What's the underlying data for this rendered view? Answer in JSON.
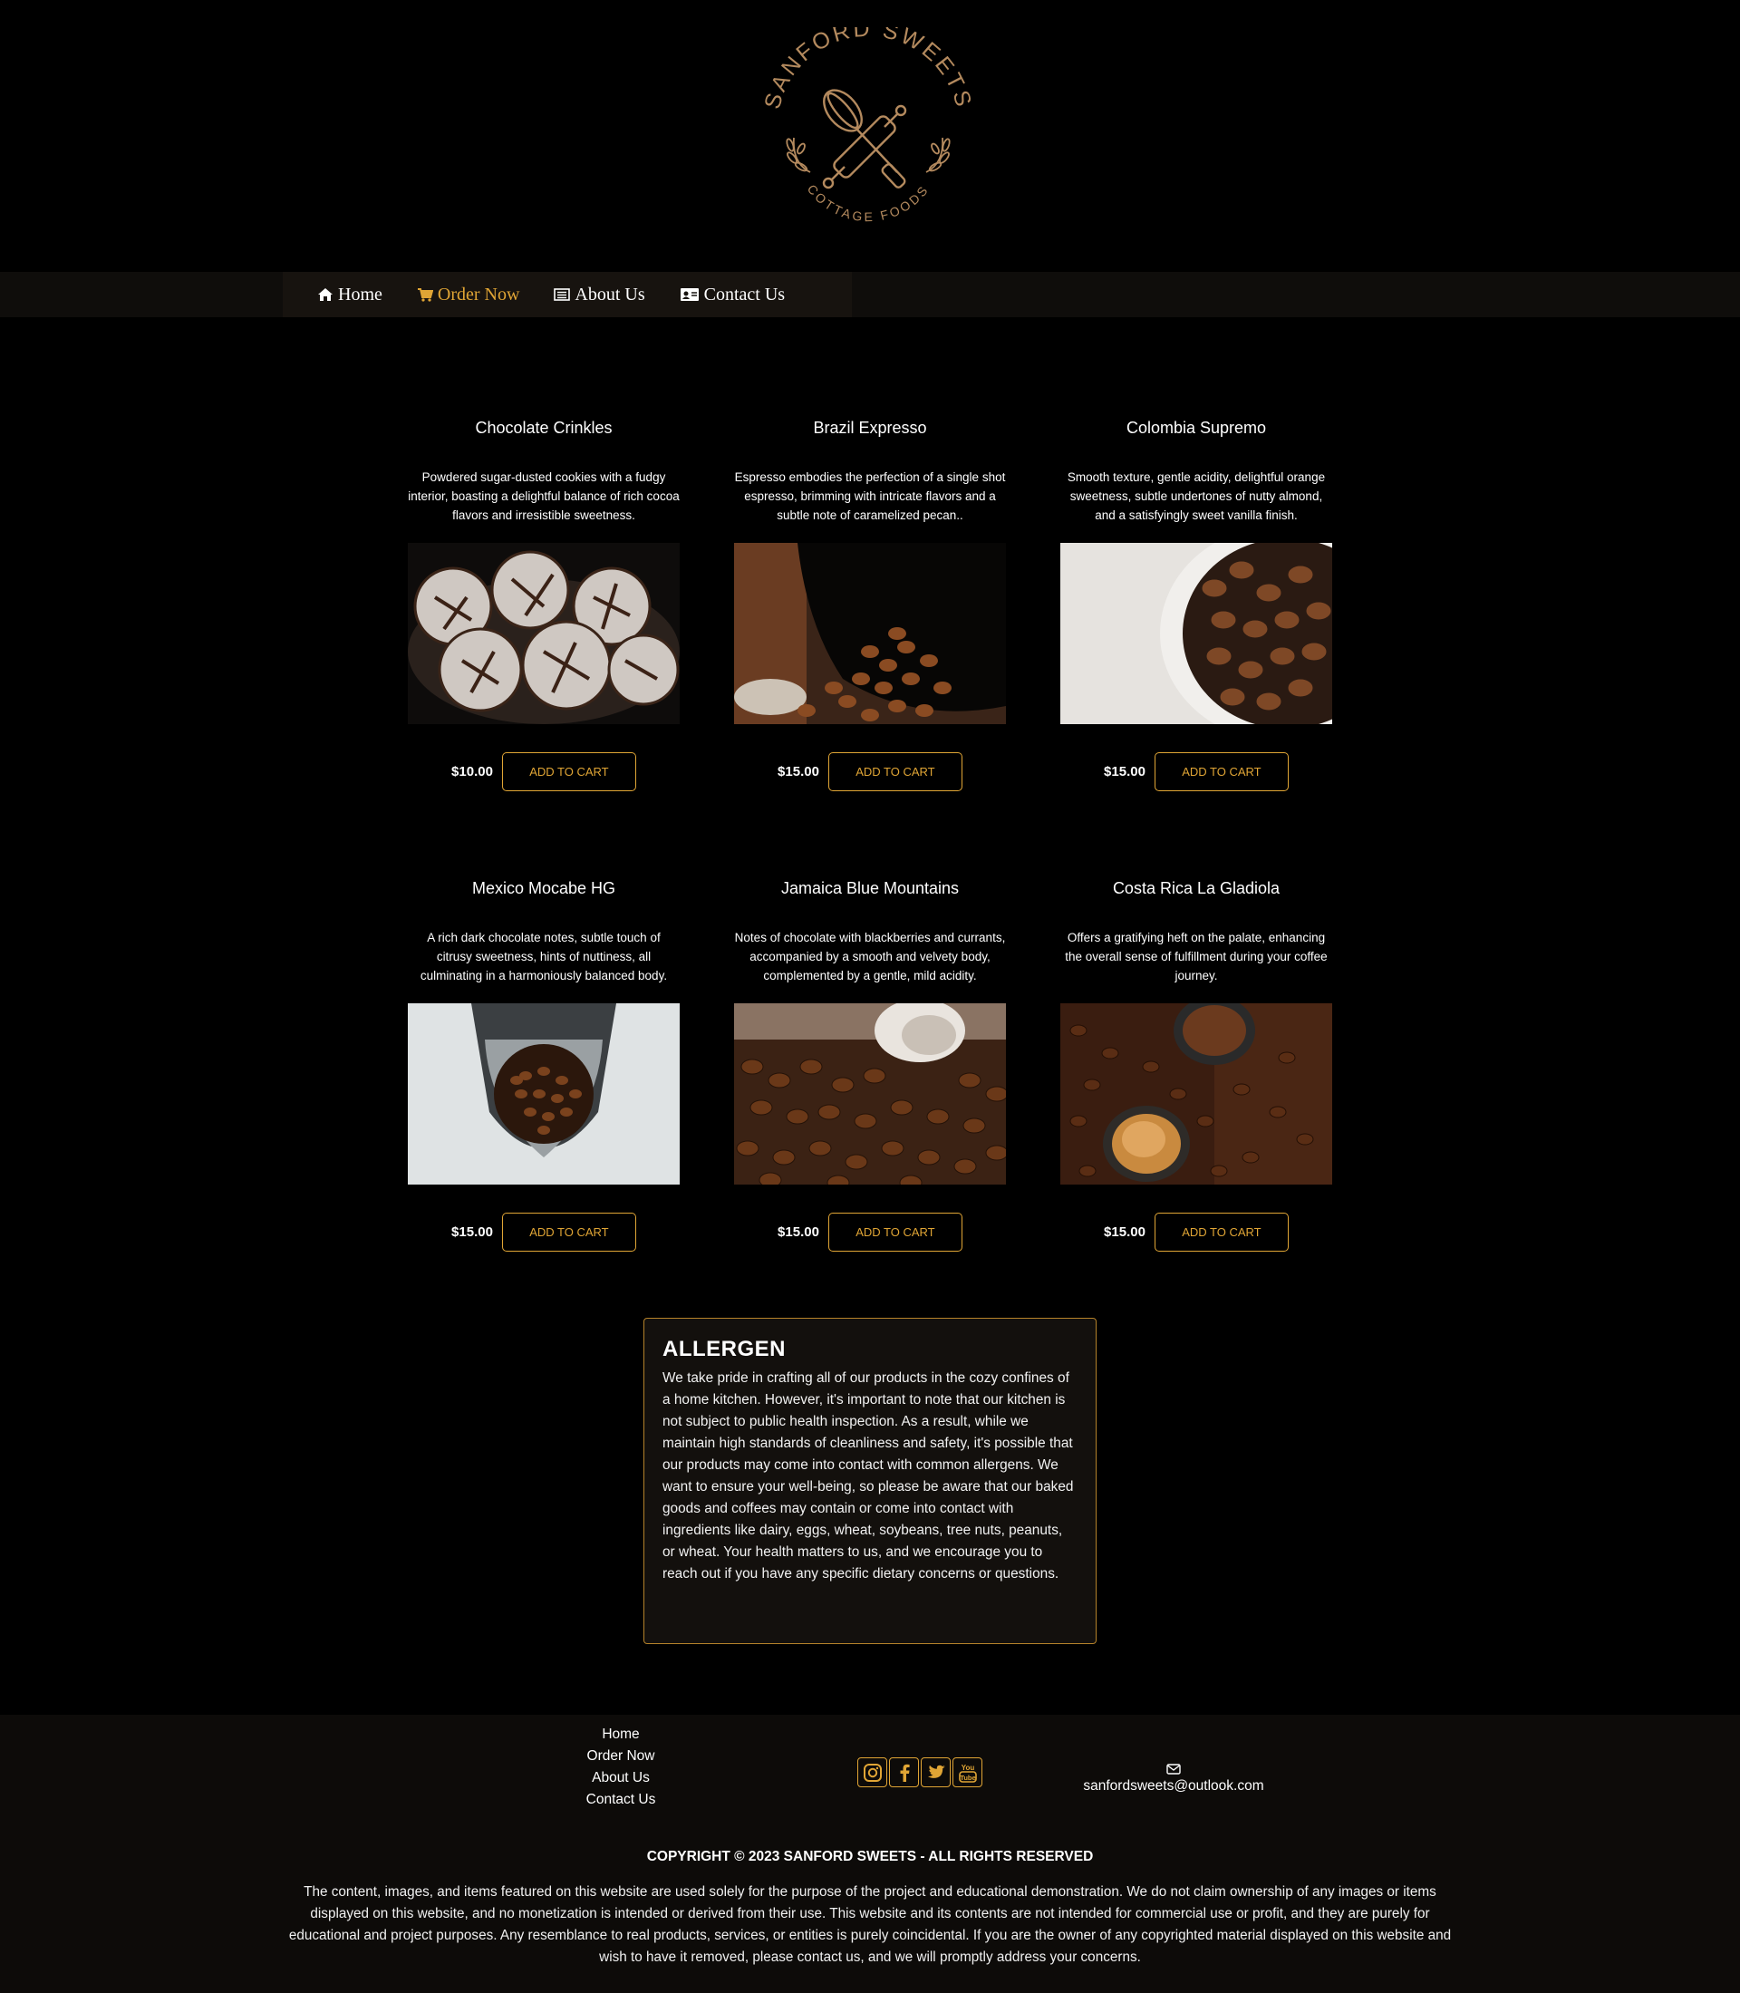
{
  "brand": {
    "name_top": "SANFORD SWEETS",
    "name_bottom": "COTTAGE FOODS"
  },
  "nav": {
    "items": [
      {
        "label": "Home",
        "icon": "home-icon"
      },
      {
        "label": "Order Now",
        "icon": "cart-icon"
      },
      {
        "label": "About Us",
        "icon": "list-icon"
      },
      {
        "label": "Contact Us",
        "icon": "contact-card-icon"
      }
    ]
  },
  "products": [
    {
      "title": "Chocolate Crinkles",
      "description": "Powdered sugar-dusted cookies with a fudgy interior, boasting a delightful balance of rich cocoa flavors and irresistible sweetness.",
      "price": "$10.00",
      "cart_label": "ADD TO CART"
    },
    {
      "title": "Brazil Expresso",
      "description": "Espresso embodies the perfection of a single shot espresso, brimming with intricate flavors and a subtle note of caramelized pecan..",
      "price": "$15.00",
      "cart_label": "ADD TO CART"
    },
    {
      "title": "Colombia Supremo",
      "description": "Smooth texture, gentle acidity, delightful orange sweetness, subtle undertones of nutty almond, and a satisfyingly sweet vanilla finish.",
      "price": "$15.00",
      "cart_label": "ADD TO CART"
    },
    {
      "title": "Mexico Mocabe HG",
      "description": "A rich dark chocolate notes, subtle touch of citrusy sweetness, hints of nuttiness, all culminating in a harmoniously balanced body.",
      "price": "$15.00",
      "cart_label": "ADD TO CART"
    },
    {
      "title": "Jamaica Blue Mountains",
      "description": "Notes of chocolate with blackberries and currants, accompanied by a smooth and velvety body, complemented by a gentle, mild acidity.",
      "price": "$15.00",
      "cart_label": "ADD TO CART"
    },
    {
      "title": "Costa Rica La Gladiola",
      "description": "Offers a gratifying heft on the palate, enhancing the overall sense of fulfillment during your coffee journey.",
      "price": "$15.00",
      "cart_label": "ADD TO CART"
    }
  ],
  "allergen": {
    "heading": "ALLERGEN",
    "body": "We take pride in crafting all of our products in the cozy confines of a home kitchen. However, it's important to note that our kitchen is not subject to public health inspection. As a result, while we maintain high standards of cleanliness and safety, it's possible that our products may come into contact with common allergens. We want to ensure your well-being, so please be aware that our baked goods and coffees may contain or come into contact with ingredients like dairy, eggs, wheat, soybeans, tree nuts, peanuts, or wheat. Your health matters to us, and we encourage you to reach out if you have any specific dietary concerns or questions."
  },
  "footer": {
    "links": [
      "Home",
      "Order Now",
      "About Us",
      "Contact Us"
    ],
    "socials": [
      "instagram-icon",
      "facebook-icon",
      "twitter-icon",
      "youtube-icon"
    ],
    "email": "sanfordsweets@outlook.com",
    "copyright": "COPYRIGHT © 2023 SANFORD SWEETS - ALL RIGHTS RESERVED",
    "disclaimer": "The content, images, and items featured on this website are used solely for the purpose of the project and educational demonstration. We do not claim ownership of any images or items displayed on this website, and no monetization is intended or derived from their use. This website and its contents are not intended for commercial use or profit, and they are purely for educational and project purposes. Any resemblance to real products, services, or entities is purely coincidental. If you are the owner of any copyrighted material displayed on this website and wish to have it removed, please contact us, and we will promptly address your concerns."
  },
  "colors": {
    "accent": "#e0a535",
    "background": "#000000",
    "panel": "#13100d"
  }
}
